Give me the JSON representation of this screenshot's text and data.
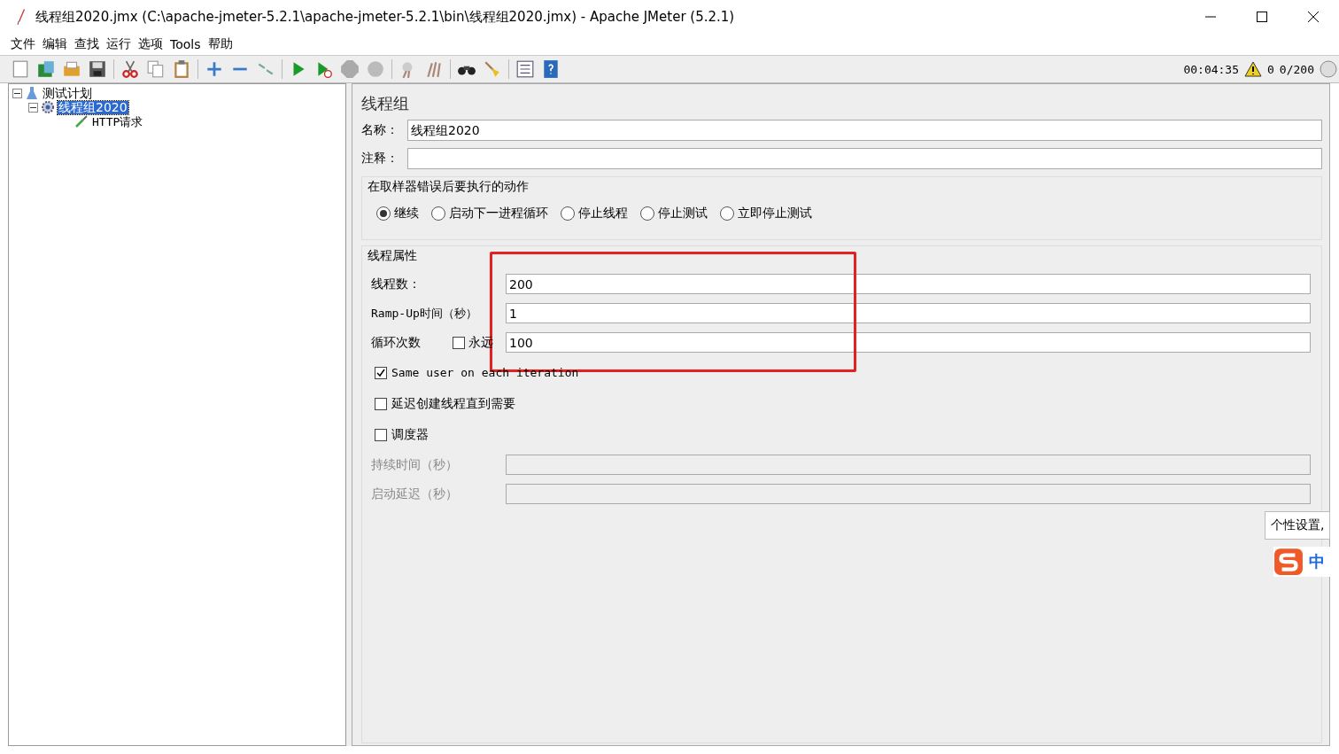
{
  "window": {
    "title": "线程组2020.jmx (C:\\apache-jmeter-5.2.1\\apache-jmeter-5.2.1\\bin\\线程组2020.jmx) - Apache JMeter (5.2.1)"
  },
  "menu": [
    "文件",
    "编辑",
    "查找",
    "运行",
    "选项",
    "Tools",
    "帮助"
  ],
  "status": {
    "elapsed": "00:04:35",
    "warnings": "0",
    "threads": "0/200"
  },
  "tree": [
    {
      "label": "测试计划",
      "expanded": true,
      "selected": false,
      "children": [
        {
          "label": "线程组2020",
          "expanded": true,
          "selected": true,
          "children": [
            {
              "label": "HTTP请求",
              "selected": false
            }
          ]
        }
      ]
    }
  ],
  "panel": {
    "title": "线程组",
    "name_label": "名称：",
    "name_value": "线程组2020",
    "comment_label": "注释：",
    "error_action": {
      "legend": "在取样器错误后要执行的动作",
      "options": [
        {
          "label": "继续",
          "selected": true
        },
        {
          "label": "启动下一进程循环",
          "selected": false
        },
        {
          "label": "停止线程",
          "selected": false
        },
        {
          "label": "停止测试",
          "selected": false
        },
        {
          "label": "立即停止测试",
          "selected": false
        }
      ]
    },
    "thread_props": {
      "legend": "线程属性",
      "threads": {
        "label": "线程数：",
        "value": "200"
      },
      "rampup": {
        "label": "Ramp-Up时间（秒）",
        "value": "1"
      },
      "loop": {
        "label": "循环次数",
        "forever_label": "永远",
        "forever_checked": false,
        "value": "100"
      },
      "same_user": {
        "label": "Same user on each iteration",
        "checked": true
      },
      "delay": {
        "label": "延迟创建线程直到需要",
        "checked": false
      },
      "scheduler": {
        "label": "调度器",
        "checked": false
      },
      "duration": {
        "label": "持续时间（秒）",
        "disabled": true
      },
      "startup_delay": {
        "label": "启动延迟（秒）",
        "disabled": true
      }
    }
  },
  "ime": {
    "tooltip": "个性设置,",
    "mode": "中"
  }
}
